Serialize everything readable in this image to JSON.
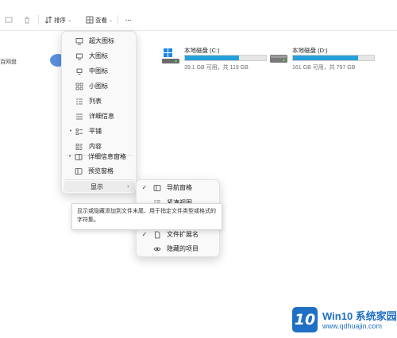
{
  "toolbar": {
    "sort_label": "排序",
    "view_label": "查看",
    "more_label": "···"
  },
  "sidebar": {
    "fragment_label": "百网盘"
  },
  "drives": [
    {
      "name": "本地磁盘 (C:)",
      "capacity": "39.1 GB 可用，共 119 GB",
      "used_fraction": 0.67
    },
    {
      "name": "本地磁盘 (D:)",
      "capacity": "161 GB 可用，共 797 GB",
      "used_fraction": 0.8
    }
  ],
  "view_menu": {
    "items": [
      "超大图标",
      "大图标",
      "中图标",
      "小图标",
      "列表",
      "详细信息",
      "平铺",
      "内容"
    ],
    "pane_items": [
      "详细信息窗格",
      "预览窗格"
    ],
    "show_label": "显示"
  },
  "show_submenu": {
    "items": [
      "导航窗格",
      "紧凑视图",
      "文件扩展名",
      "隐藏的项目"
    ]
  },
  "tooltip": {
    "text": "显示或隐藏添加到文件末尾、用于指定文件类型或格式的字符集。"
  },
  "watermark": {
    "title": "Win10 系统家园",
    "url": "www.qdhuajin.com",
    "badge": "10"
  },
  "colors": {
    "accent": "#26a0da",
    "logo_blue": "#1f6fc4",
    "menu_bg": "#f9f9f9"
  }
}
